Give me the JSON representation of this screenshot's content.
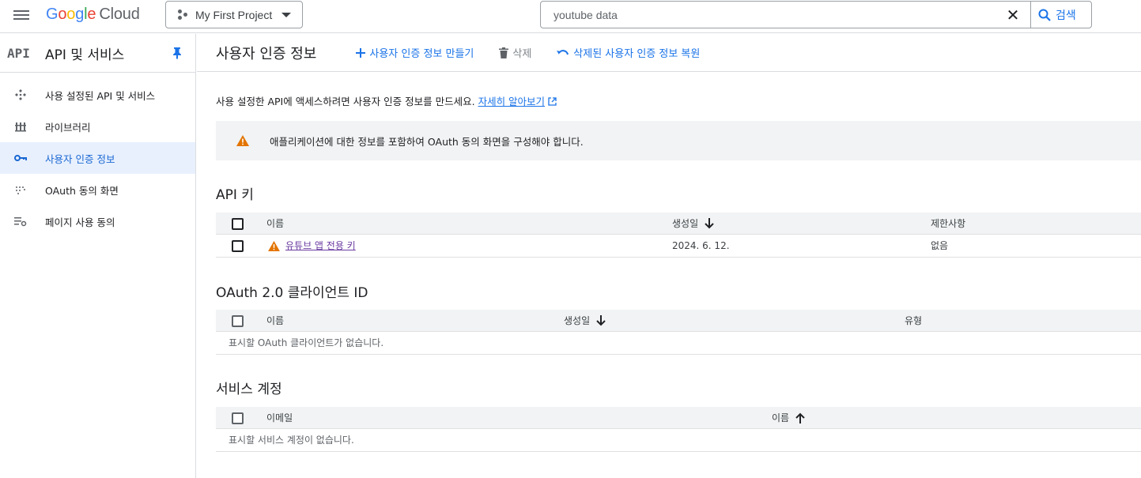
{
  "topbar": {
    "logo_google": [
      "G",
      "o",
      "o",
      "g",
      "l",
      "e"
    ],
    "logo_cloud": "Cloud",
    "project_label": "My First Project",
    "search_value": "youtube data",
    "search_button": "검색"
  },
  "sidebar": {
    "badge": "API",
    "title": "API 및 서비스",
    "items": [
      {
        "label": "사용 설정된 API 및 서비스",
        "icon": "api-diamond-icon",
        "active": false
      },
      {
        "label": "라이브러리",
        "icon": "library-icon",
        "active": false
      },
      {
        "label": "사용자 인증 정보",
        "icon": "key-icon",
        "active": true
      },
      {
        "label": "OAuth 동의 화면",
        "icon": "oauth-dots-icon",
        "active": false
      },
      {
        "label": "페이지 사용 동의",
        "icon": "settings-list-icon",
        "active": false
      }
    ]
  },
  "main": {
    "title": "사용자 인증 정보",
    "create_label": "사용자 인증 정보 만들기",
    "delete_label": "삭제",
    "restore_label": "삭제된 사용자 인증 정보 복원",
    "intro_text": "사용 설정한 API에 액세스하려면 사용자 인증 정보를 만드세요.",
    "intro_link": "자세히 알아보기",
    "notice": "애플리케이션에 대한 정보를 포함하여 OAuth 동의 화면을 구성해야 합니다."
  },
  "api_keys": {
    "title": "API 키",
    "headers": {
      "name": "이름",
      "created": "생성일",
      "restrictions": "제한사항"
    },
    "rows": [
      {
        "name": "유튜브 앱 전용 키",
        "created": "2024. 6. 12.",
        "restrictions": "없음"
      }
    ]
  },
  "oauth": {
    "title": "OAuth 2.0 클라이언트 ID",
    "headers": {
      "name": "이름",
      "created": "생성일",
      "type": "유형"
    },
    "empty": "표시할 OAuth 클라이언트가 없습니다."
  },
  "service_accounts": {
    "title": "서비스 계정",
    "headers": {
      "email": "이메일",
      "name": "이름"
    },
    "empty": "표시할 서비스 계정이 없습니다."
  },
  "colors": {
    "accent": "#1a73e8",
    "warning": "#e37400",
    "active_bg": "#e8f0fe"
  }
}
